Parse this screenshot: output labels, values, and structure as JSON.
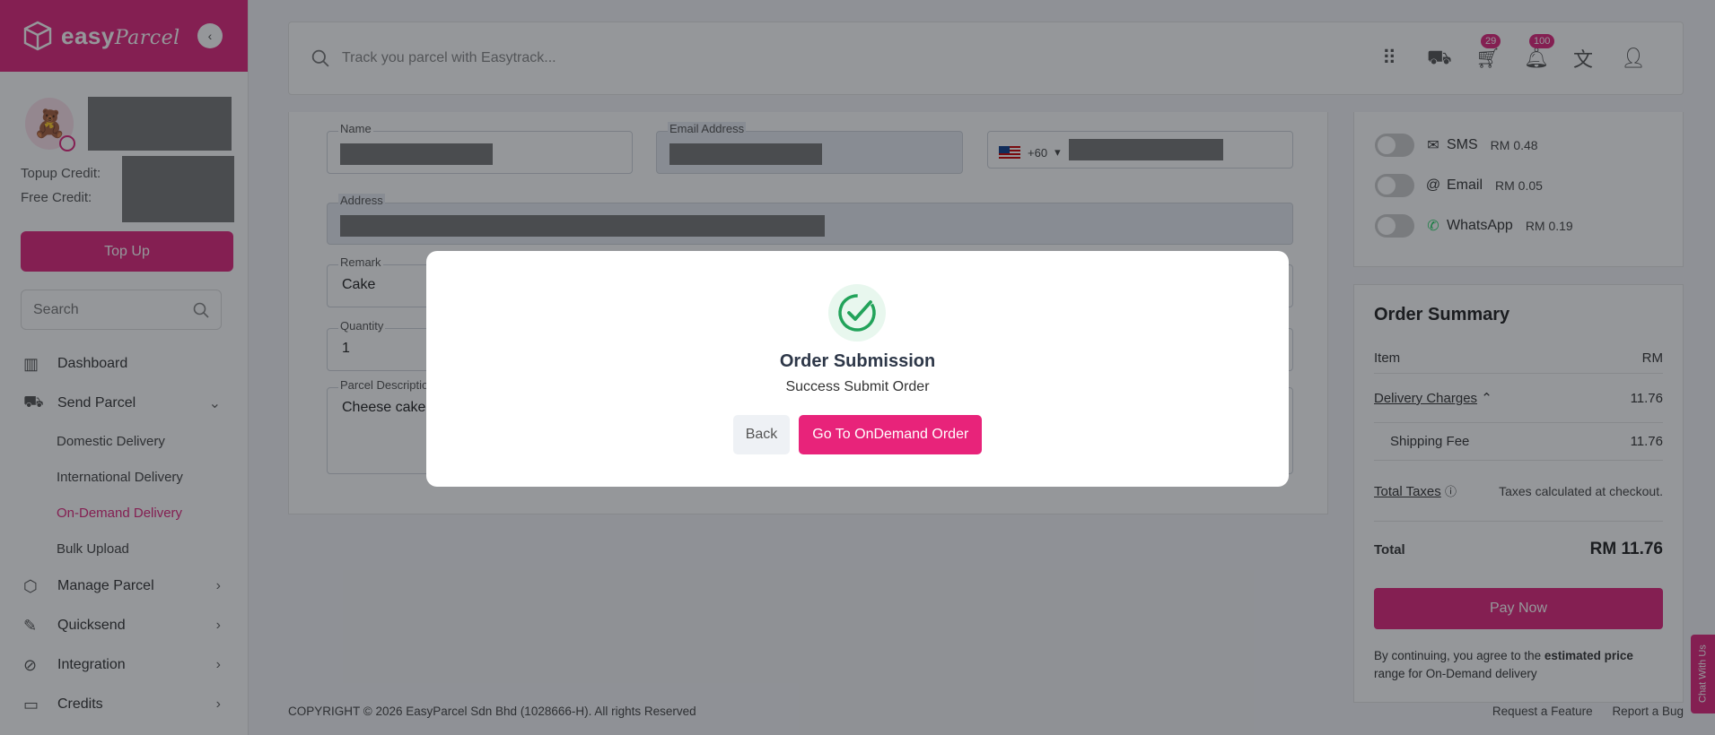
{
  "brand": {
    "logo_text": "easy",
    "logo_script": "Parcel",
    "accent": "#e0267d"
  },
  "sidebar": {
    "credit_labels": [
      "Topup Credit:",
      "Free Credit:"
    ],
    "topup_label": "Top Up",
    "search_placeholder": "Search",
    "nav": [
      {
        "label": "Dashboard",
        "icon": "bar-chart-icon"
      },
      {
        "label": "Send Parcel",
        "icon": "truck-icon",
        "expanded": true
      },
      {
        "label": "Manage Parcel",
        "icon": "box-icon"
      },
      {
        "label": "Quicksend",
        "icon": "quicksend-icon"
      },
      {
        "label": "Integration",
        "icon": "link-icon"
      },
      {
        "label": "Credits",
        "icon": "wallet-icon"
      }
    ],
    "sub_items": [
      "Domestic Delivery",
      "International Delivery",
      "On-Demand Delivery",
      "Bulk Upload"
    ],
    "active_sub": "On-Demand Delivery"
  },
  "topbar": {
    "search_placeholder": "Track you parcel with Easytrack...",
    "cart_count": "29",
    "notification_count": "100"
  },
  "form": {
    "name_label": "Name",
    "email_label": "Email Address",
    "phone_code": "+60",
    "address_label": "Address",
    "remark_label": "Remark",
    "remark_value": "Cake",
    "quantity_label": "Quantity",
    "quantity_value": "1",
    "description_label": "Parcel Description",
    "description_value": "Cheese cake x"
  },
  "notifications": [
    {
      "label": "SMS",
      "price": "RM 0.48",
      "icon": "mail-icon"
    },
    {
      "label": "Email",
      "price": "RM 0.05",
      "icon": "at-icon"
    },
    {
      "label": "WhatsApp",
      "price": "RM 0.19",
      "icon": "whatsapp-icon"
    }
  ],
  "summary": {
    "title": "Order Summary",
    "item_label": "Item",
    "currency_label": "RM",
    "delivery_label": "Delivery Charges",
    "delivery_value": "11.76",
    "shipping_label": "Shipping Fee",
    "shipping_value": "11.76",
    "taxes_label": "Total Taxes",
    "taxes_value": "Taxes calculated at checkout.",
    "total_label": "Total",
    "total_value": "RM 11.76",
    "pay_label": "Pay Now",
    "agree_pre": "By continuing, you agree to the ",
    "agree_bold": "estimated price",
    "agree_post": "range for On-Demand delivery"
  },
  "footer": {
    "copyright": "COPYRIGHT © 2026 EasyParcel Sdn Bhd (1028666-H). All rights Reserved",
    "request_feature": "Request a Feature",
    "report_bug": "Report a Bug"
  },
  "chat_label": "Chat With Us",
  "modal": {
    "title": "Order Submission",
    "message": "Success Submit Order",
    "back_label": "Back",
    "go_label": "Go To OnDemand Order",
    "success_color": "#22a35a"
  }
}
